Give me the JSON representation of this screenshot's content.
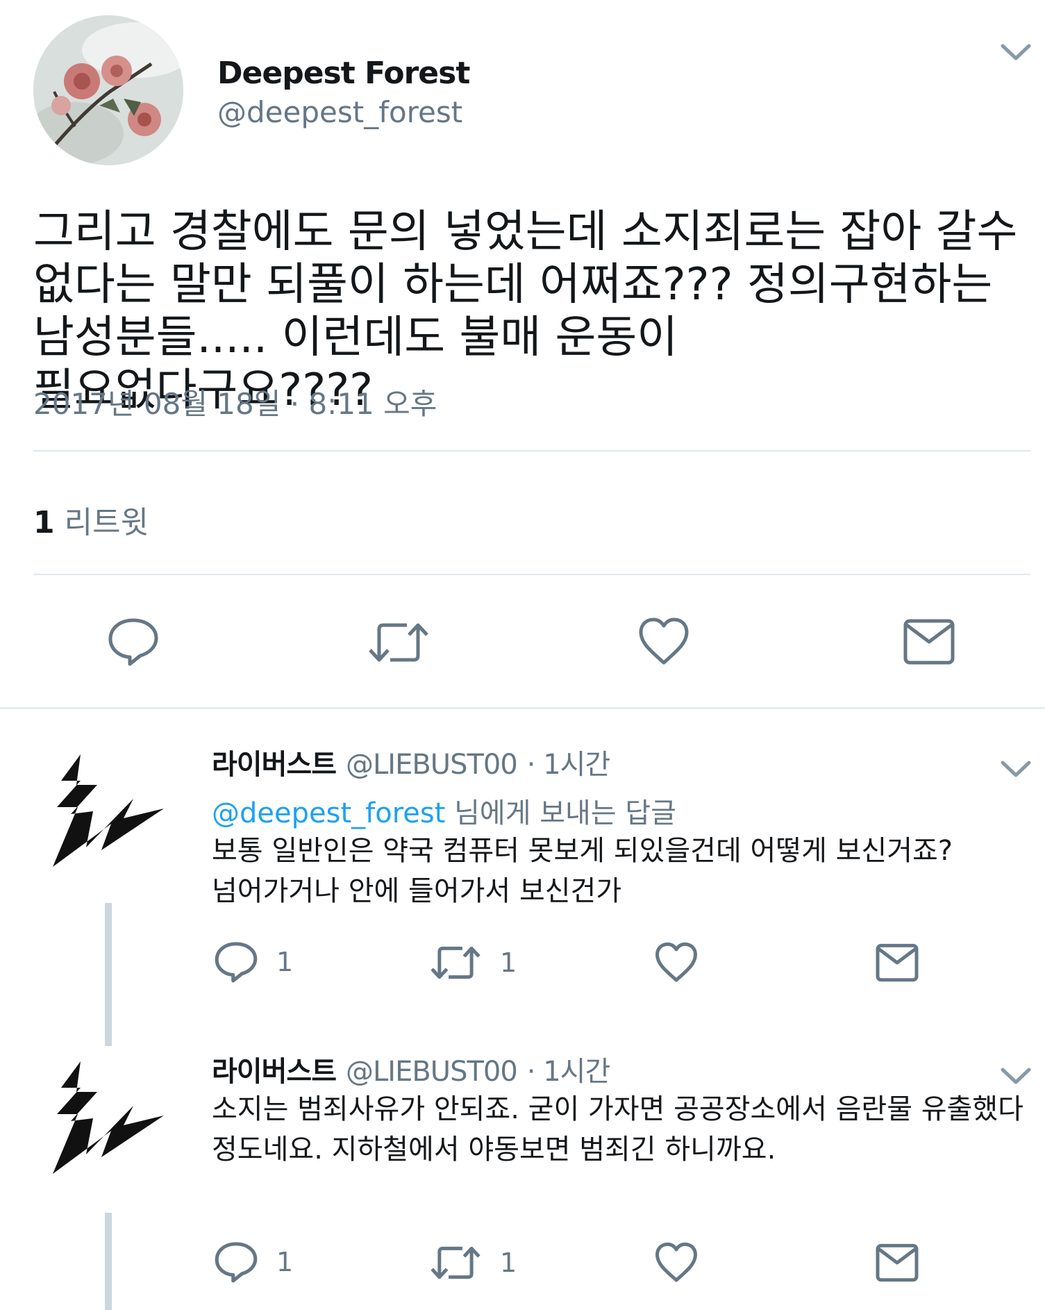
{
  "tweet": {
    "author_name": "Deepest Forest",
    "author_handle": "@deepest_forest",
    "text": "그리고 경찰에도 문의 넣었는데 소지죄로는 잡아 갈수\n없다는 말만 되풀이 하는데 어쩌죠??? 정의구현하는\n남성분들..... 이런데도 불매 운동이 필요없다구요????",
    "timestamp": "2017년 08월 18일 · 8:11 오후",
    "retweet_count": "1",
    "retweet_label": "리트윗"
  },
  "replies": [
    {
      "name": "라이버스트",
      "handle": "@LIEBUST00",
      "time": "· 1시간",
      "replying_to_link": "@deepest_forest",
      "replying_to_suffix": " 님에게 보내는 답글",
      "text": "보통 일반인은 약국 컴퓨터 못보게 되있을건데 어떻게 보신거죠?\n넘어가거나 안에 들어가서 보신건가",
      "reply_count": "1",
      "retweet_count": "1"
    },
    {
      "name": "라이버스트",
      "handle": "@LIEBUST00",
      "time": "· 1시간",
      "text": "소지는 범죄사유가 안되죠. 굳이 가자면 공공장소에서 음란물 유출했다\n정도네요. 지하철에서 야동보면 범죄긴 하니까요.",
      "reply_count": "1",
      "retweet_count": "1"
    }
  ],
  "colors": {
    "text": "#14171a",
    "secondary": "#657786",
    "link": "#1da1f2",
    "divider": "#e1e8ed"
  },
  "icons": [
    "chevron-down-icon",
    "reply-icon",
    "retweet-icon",
    "like-icon",
    "message-icon"
  ]
}
